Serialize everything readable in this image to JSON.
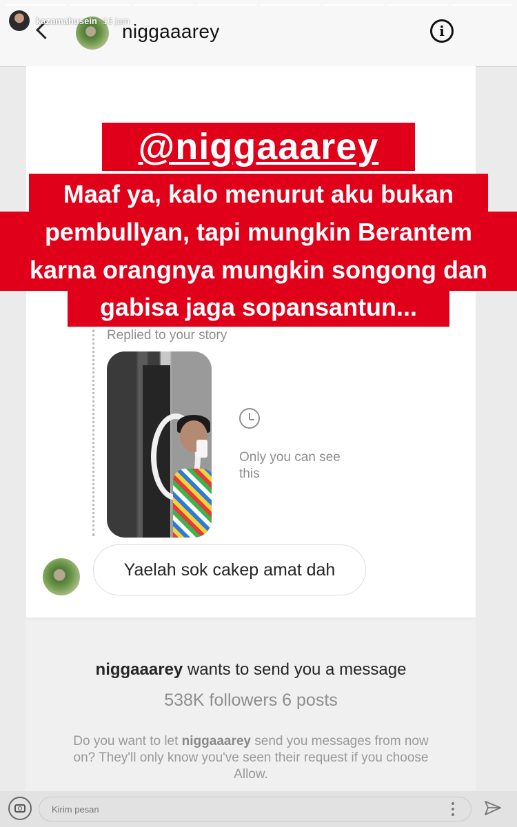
{
  "story": {
    "username": "kazamahusein",
    "time": "16 jam",
    "segments": 8
  },
  "dm_header": {
    "title": "niggaaarey"
  },
  "overlay": {
    "handle": "@niggaaarey",
    "lines": [
      "Maaf ya, kalo menurut aku bukan",
      "pembullyan, tapi mungkin Berantem",
      "karna orangnya mungkin songong dan",
      "gabisa jaga sopansantun..."
    ]
  },
  "chat": {
    "replied_label": "Replied to your story",
    "only_you_text": "Only you can see this",
    "message": "Yaelah sok cakep amat dah"
  },
  "request": {
    "username": "niggaaarey",
    "title_rest": " wants to send you a message",
    "followers": "538K followers",
    "posts": "6 posts",
    "body_pre": "Do you want to let ",
    "body_user": "niggaaarey",
    "body_post": " send you messages from now on? They'll only know you've seen their request if you choose Allow."
  },
  "reply_bar": {
    "placeholder": "Kirim pesan"
  },
  "colors": {
    "overlay_red": "#e0001a",
    "secondary_gray": "#8e8e8e"
  },
  "icons": [
    "back-chevron-icon",
    "info-icon",
    "history-icon",
    "camera-icon",
    "more-options-icon",
    "send-icon"
  ]
}
